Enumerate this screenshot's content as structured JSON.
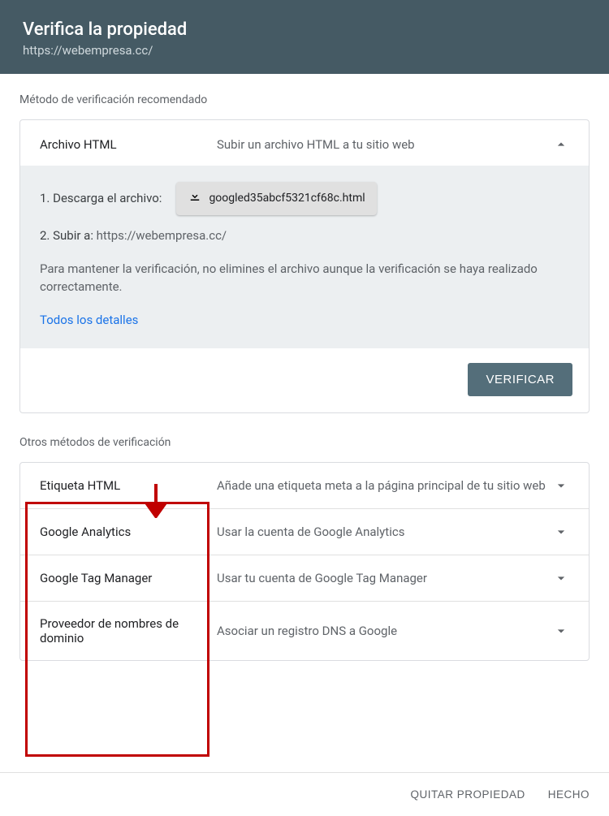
{
  "header": {
    "title": "Verifica la propiedad",
    "url": "https://webempresa.cc/"
  },
  "recommended": {
    "section_label": "Método de verificación recomendado",
    "method_title": "Archivo HTML",
    "method_desc": "Subir un archivo HTML a tu sitio web",
    "step1_label": "1. Descarga el archivo:",
    "file_name": "googled35abcf5321cf68c.html",
    "step2_prefix": "2. Subir a: ",
    "step2_url": "https://webempresa.cc/",
    "note": "Para mantener la verificación, no elimines el archivo aunque la verificación se haya realizado correctamente.",
    "details_link": "Todos los detalles",
    "verify_button": "VERIFICAR"
  },
  "other": {
    "section_label": "Otros métodos de verificación",
    "methods": [
      {
        "title": "Etiqueta HTML",
        "desc": "Añade una etiqueta meta a la página principal de tu sitio web"
      },
      {
        "title": "Google Analytics",
        "desc": "Usar la cuenta de Google Analytics"
      },
      {
        "title": "Google Tag Manager",
        "desc": "Usar tu cuenta de Google Tag Manager"
      },
      {
        "title": "Proveedor de nombres de dominio",
        "desc": "Asociar un registro DNS a Google"
      }
    ]
  },
  "footer": {
    "remove": "QUITAR PROPIEDAD",
    "done": "HECHO"
  }
}
